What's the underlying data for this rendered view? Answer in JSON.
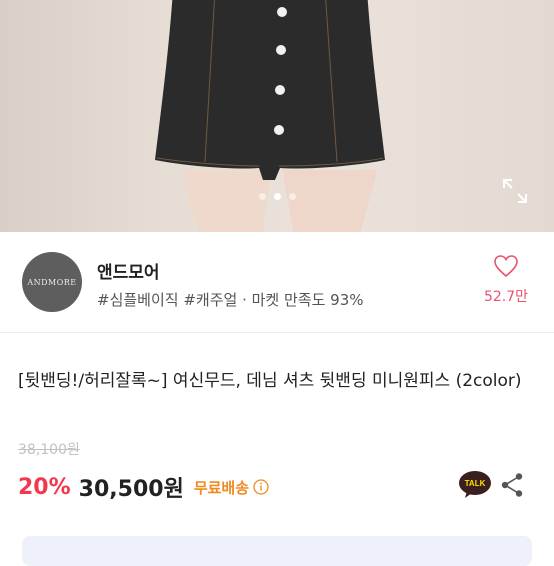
{
  "product_image": {
    "alt": "",
    "carousel_total": 3,
    "carousel_active": 2,
    "expand_icon": "expand-icon"
  },
  "seller": {
    "avatar_text": "ANDMORE",
    "name": "앤드모어",
    "tags": "#심플베이직 #캐주얼 · 마켓 만족도 93%",
    "like_count": "52.7만",
    "like_icon": "heart-outline-icon",
    "like_color": "#e8546d"
  },
  "product": {
    "title": "[뒷밴딩!/허리잘록~] 여신무드, 데님 셔츠 뒷밴딩 미니원피스 (2color)",
    "original_price": "38,100원",
    "discount": "20%",
    "price": "30,500원",
    "shipping": "무료배송",
    "discount_color": "#f3374f",
    "shipping_color": "#f08a1f"
  },
  "actions": {
    "talk_label": "TALK",
    "share_icon": "share-icon"
  }
}
